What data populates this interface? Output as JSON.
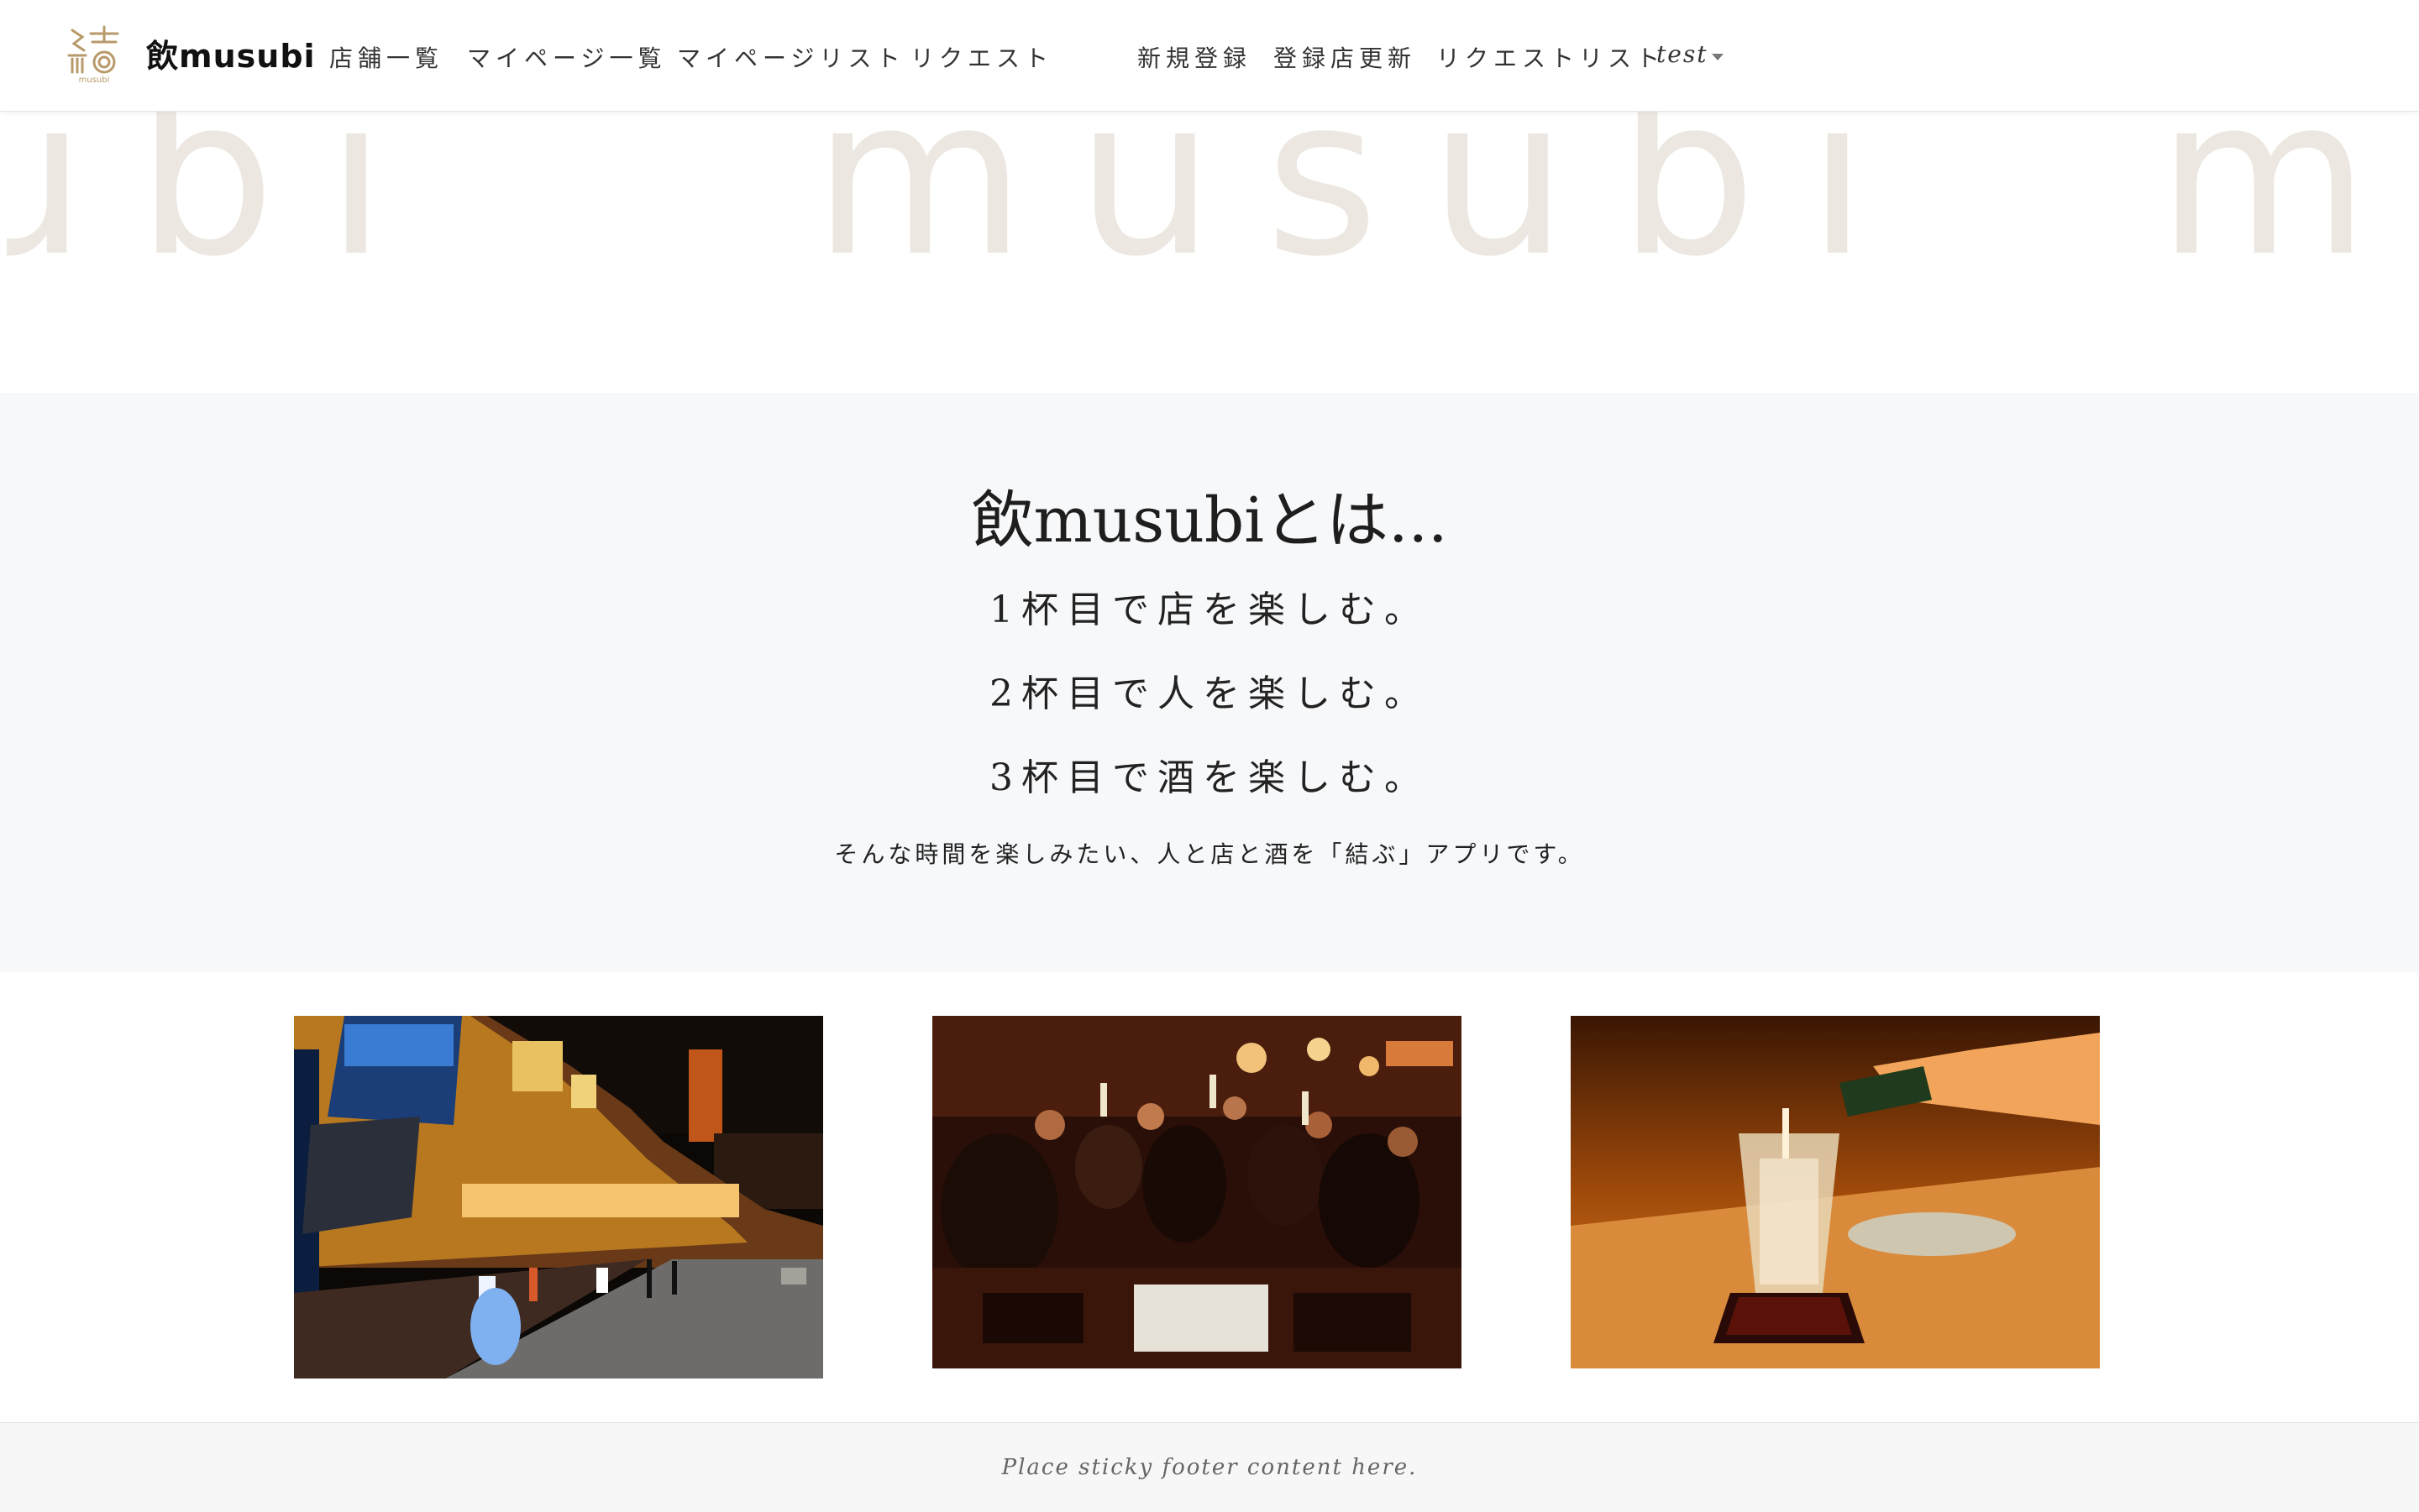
{
  "navbar": {
    "brand": "飲musubi",
    "logo_caption": "musubi",
    "items": [
      {
        "label": "店舗一覧"
      },
      {
        "label": "マイページ一覧"
      },
      {
        "label": "マイページリスト"
      },
      {
        "label": "リクエスト"
      },
      {
        "label": "新規登録"
      },
      {
        "label": "登録店更新"
      },
      {
        "label": "リクエストリスト"
      }
    ],
    "user": "test",
    "user_icon": "caret-down-icon"
  },
  "hero": {
    "watermark_left": "ubi",
    "watermark_center": "musubi",
    "watermark_right": "mu",
    "watermark_color": "#ece8e1"
  },
  "about": {
    "title": "飲musubiとは...",
    "lines": [
      "1杯目で店を楽しむ。",
      "2杯目で人を楽しむ。",
      "3杯目で酒を楽しむ。"
    ],
    "subtitle": "そんな時間を楽しみたい、人と店と酒を「結ぶ」アプリです。"
  },
  "gallery": {
    "photos": [
      {
        "name": "night-street-photo"
      },
      {
        "name": "toast-party-photo"
      },
      {
        "name": "sake-pour-photo"
      }
    ]
  },
  "footer": {
    "text": "Place sticky footer content here."
  },
  "colors": {
    "navbar_bg": "#ffffff",
    "about_bg": "#f7f8fa",
    "footer_bg": "#f7f7f7",
    "logo_gold": "#b89a6a"
  }
}
